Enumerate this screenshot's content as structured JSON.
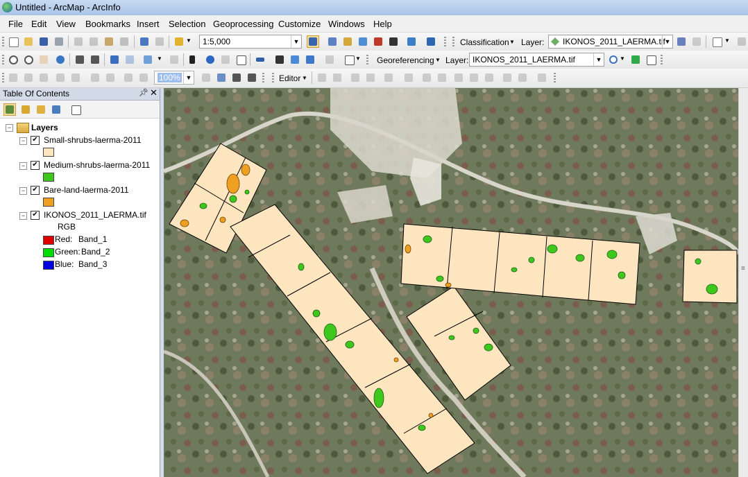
{
  "window": {
    "title": "Untitled - ArcMap - ArcInfo"
  },
  "menu": [
    "File",
    "Edit",
    "View",
    "Bookmarks",
    "Insert",
    "Selection",
    "Geoprocessing",
    "Customize",
    "Windows",
    "Help"
  ],
  "toolbar_standard": {
    "scale_value": "1:5,000"
  },
  "toolbar_classification": {
    "label": "Classification",
    "layer_label": "Layer:",
    "layer_value": "IKONOS_2011_LAERMA.tif"
  },
  "toolbar_georef": {
    "label": "Georeferencing",
    "layer_label": "Layer:",
    "layer_value": "IKONOS_2011_LAERMA.tif"
  },
  "toolbar_editor": {
    "zoom_value": "100%",
    "editor_label": "Editor"
  },
  "toc": {
    "title": "Table Of Contents",
    "root": "Layers",
    "layers": [
      {
        "name": "Small-shrubs-laerma-2011",
        "checked": true,
        "swatch_color": "#fde5c0"
      },
      {
        "name": "Medium-shrubs-laerma-2011",
        "checked": true,
        "swatch_color": "#3ec81e"
      },
      {
        "name": "Bare-land-laerma-2011",
        "checked": true,
        "swatch_color": "#f0a020"
      },
      {
        "name": "IKONOS_2011_LAERMA.tif",
        "checked": true,
        "rgb_label": "RGB",
        "bands": [
          {
            "label": "Red:",
            "band": "Band_1",
            "color": "#e00000"
          },
          {
            "label": "Green:",
            "band": "Band_2",
            "color": "#00e000"
          },
          {
            "label": "Blue:",
            "band": "Band_3",
            "color": "#0000e0"
          }
        ]
      }
    ]
  },
  "icons": {
    "standard": [
      "new-document-icon",
      "open-icon",
      "save-icon",
      "print-icon",
      "cut-icon",
      "copy-icon",
      "paste-icon",
      "delete-icon",
      "undo-icon",
      "redo-icon",
      "add-data-icon"
    ],
    "standard_right": [
      "editor-toolbar-icon",
      "toc-window-icon",
      "catalog-icon",
      "search-window-icon",
      "arctoolbox-icon",
      "python-icon",
      "model-builder-icon",
      "whats-this-icon"
    ],
    "tools": [
      "zoom-in-icon",
      "zoom-out-icon",
      "pan-icon",
      "full-extent-icon",
      "fixed-zoom-in-icon",
      "fixed-zoom-out-icon",
      "back-extent-icon",
      "forward-extent-icon",
      "select-features-icon",
      "clear-selection-icon",
      "select-elements-icon",
      "identify-icon",
      "find-icon",
      "html-popup-icon",
      "measure-icon",
      "binoculars-icon",
      "find-route-icon",
      "go-to-xy-icon",
      "time-slider-icon",
      "create-viewer-icon"
    ]
  },
  "colors": {
    "small_shrubs": "#fde5c0",
    "medium_shrubs": "#3ec81e",
    "bare_land": "#f0a020",
    "imagery": "#748062"
  }
}
